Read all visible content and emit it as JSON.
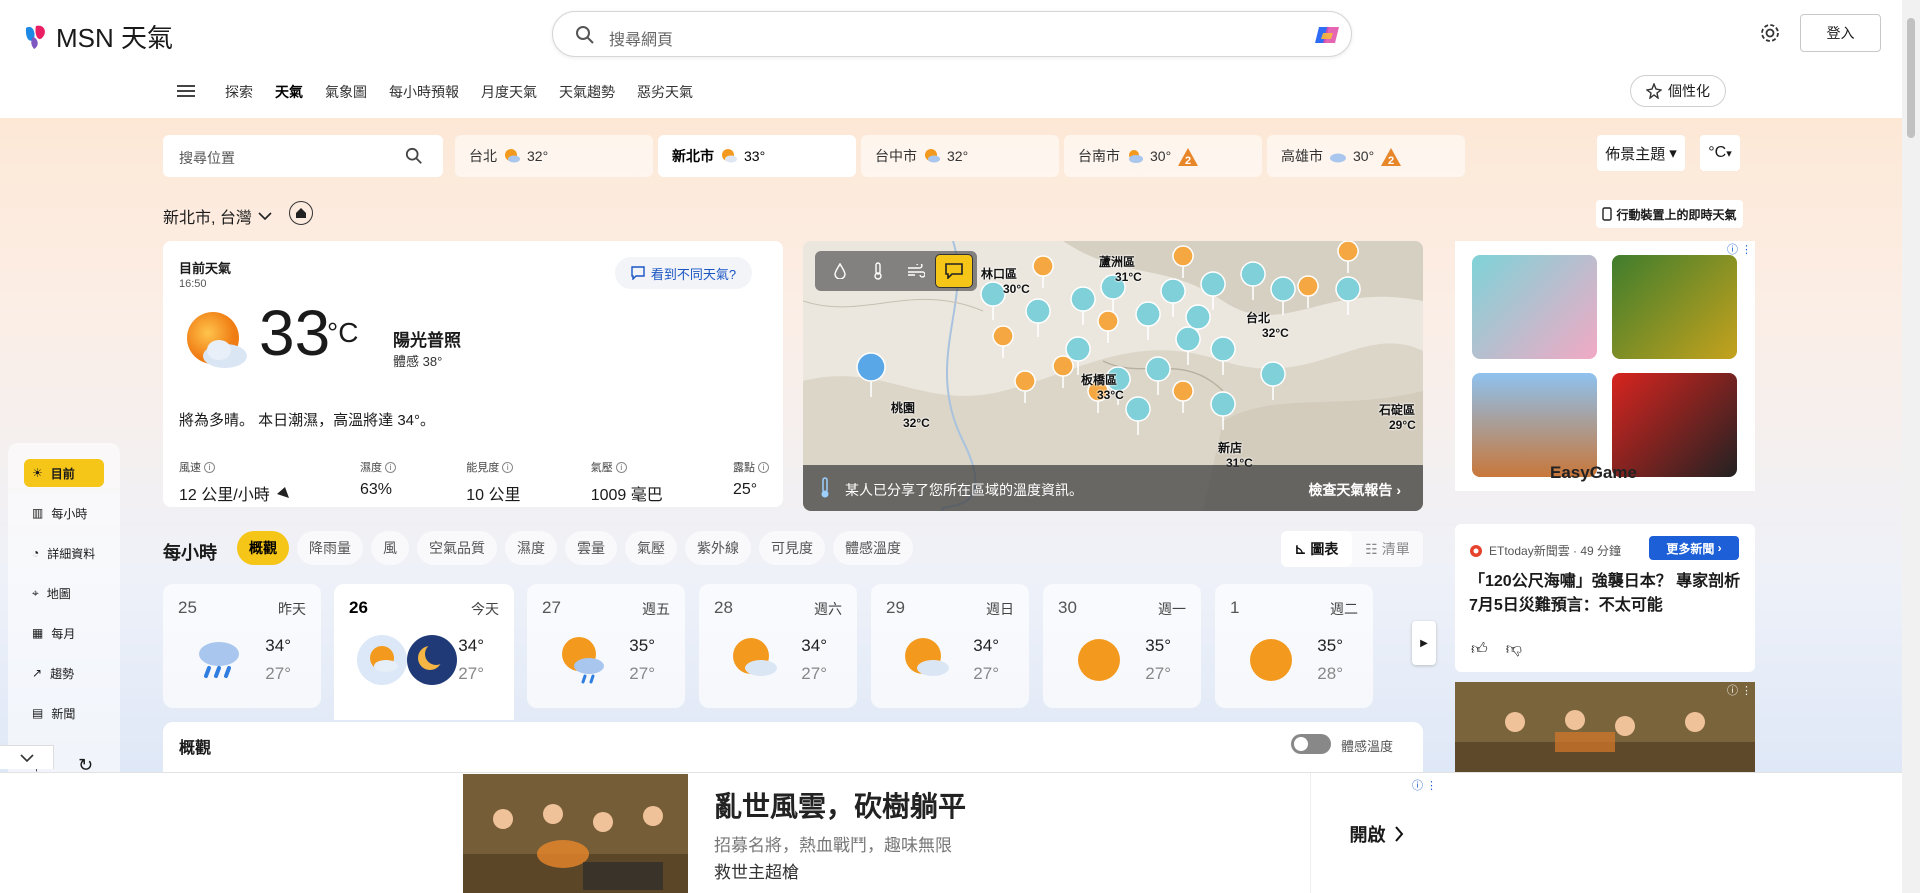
{
  "header": {
    "brand": "MSN 天氣",
    "search_placeholder": "搜尋網頁",
    "login": "登入"
  },
  "nav": {
    "links": [
      "探索",
      "天氣",
      "氣象圖",
      "每小時預報",
      "月度天氣",
      "天氣趨勢",
      "惡劣天氣"
    ],
    "active": "天氣",
    "personalize": "個性化"
  },
  "location_bar": {
    "search_placeholder": "搜尋位置",
    "cities": [
      {
        "name": "台北",
        "temp": "32°",
        "alert": false
      },
      {
        "name": "新北市",
        "temp": "33°",
        "alert": false
      },
      {
        "name": "台中市",
        "temp": "32°",
        "alert": false
      },
      {
        "name": "台南市",
        "temp": "30°",
        "alert": true
      },
      {
        "name": "高雄市",
        "temp": "30°",
        "alert": true
      }
    ],
    "theme": "佈景主題",
    "unit": "°C"
  },
  "location": {
    "name": "新北市, 台灣",
    "mobile_link": "行動裝置上的即時天氣"
  },
  "current": {
    "label": "目前天氣",
    "time": "16:50",
    "feedback": "看到不同天氣?",
    "temp": "33",
    "unit": "°C",
    "condition": "陽光普照",
    "feels_like": "體感   38°",
    "description": "將為多晴。 本日潮濕，高溫將達 34°。",
    "metrics": [
      {
        "label": "風速",
        "value": "12 公里/小時"
      },
      {
        "label": "濕度",
        "value": "63%"
      },
      {
        "label": "能見度",
        "value": "10 公里"
      },
      {
        "label": "氣壓",
        "value": "1009 毫巴"
      },
      {
        "label": "露點",
        "value": "25°"
      }
    ]
  },
  "map": {
    "labels": [
      {
        "name": "林口區",
        "temp": "30°C"
      },
      {
        "name": "蘆洲區",
        "temp": "31°C"
      },
      {
        "name": "台北",
        "temp": "32°C"
      },
      {
        "name": "桃園",
        "temp": "32°C"
      },
      {
        "name": "板橋區",
        "temp": "33°C"
      },
      {
        "name": "新店",
        "temp": "31°C"
      },
      {
        "name": "石碇區",
        "temp": "29°C"
      }
    ],
    "banner_text": "某人已分享了您所在區域的溫度資訊。",
    "banner_link": "檢查天氣報告"
  },
  "sidenav": {
    "items": [
      "目前",
      "每小時",
      "詳細資料",
      "地圖",
      "每月",
      "趨勢",
      "新聞"
    ],
    "active": "目前"
  },
  "hourly": {
    "title": "每小時",
    "chips": [
      "概觀",
      "降雨量",
      "風",
      "空氣品質",
      "濕度",
      "雲量",
      "氣壓",
      "紫外線",
      "可見度",
      "體感溫度"
    ],
    "active_chip": "概觀",
    "view_chart": "圖表",
    "view_list": "清單"
  },
  "days": [
    {
      "date": "25",
      "weekday": "昨天",
      "high": "34°",
      "low": "27°",
      "icon": "rain-icon"
    },
    {
      "date": "26",
      "weekday": "今天",
      "high": "34°",
      "low": "27°",
      "icon": "sun-moon-icon"
    },
    {
      "date": "27",
      "weekday": "週五",
      "high": "35°",
      "low": "27°",
      "icon": "sun-cloud-rain-icon"
    },
    {
      "date": "28",
      "weekday": "週六",
      "high": "34°",
      "low": "27°",
      "icon": "sun-cloud-icon"
    },
    {
      "date": "29",
      "weekday": "週日",
      "high": "34°",
      "low": "27°",
      "icon": "sun-cloud-icon"
    },
    {
      "date": "30",
      "weekday": "週一",
      "high": "35°",
      "low": "27°",
      "icon": "sun-icon"
    },
    {
      "date": "1",
      "weekday": "週二",
      "high": "35°",
      "low": "28°",
      "icon": "sun-icon"
    }
  ],
  "overview": {
    "title": "概觀",
    "toggle_label": "體感溫度"
  },
  "ads": {
    "easygame": "EasyGame",
    "news_source": "ETtoday新聞雲 · 49 分鐘",
    "news_more": "更多新聞",
    "news_headline": "「120公尺海嘯」強襲日本？ 專家剖析7月5日災難預言：不太可能",
    "bottom_headline": "亂世風雲，砍樹躺平",
    "bottom_sub": "招募名將，熱血戰鬥，趣味無限",
    "bottom_brand": "救世主超槍",
    "bottom_cta": "開啟"
  },
  "colors": {
    "accent": "#f5c518",
    "link_blue": "#1c5fd6",
    "alert_orange": "#e8862a"
  }
}
